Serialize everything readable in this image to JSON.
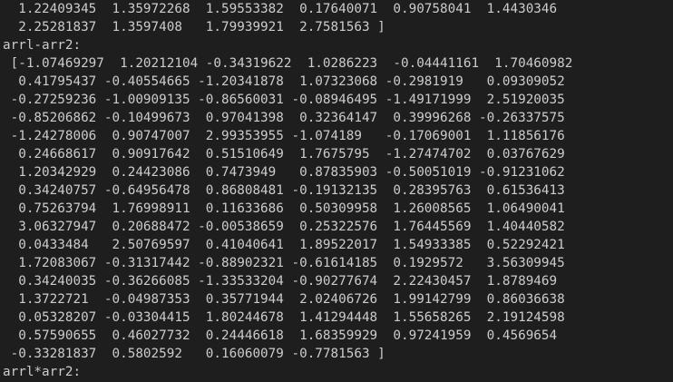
{
  "console": {
    "lines": [
      "  1.22409345  1.35972268  1.59553382  0.17640071  0.90758041  1.4430346",
      "  2.25281837  1.3597408   1.79939921  2.7581563 ]",
      "arrl-arr2:",
      " [-1.07469297  1.20212104 -0.34319622  1.0286223  -0.04441161  1.70460982",
      "  0.41795437 -0.40554665 -1.20341878  1.07323068 -0.2981919   0.09309052",
      " -0.27259236 -1.00909135 -0.86560031 -0.08946495 -1.49171999  2.51920035",
      " -0.85206862 -0.10499673  0.97041398  0.32364147  0.39996268 -0.26337575",
      " -1.24278006  0.90747007  2.99353955 -1.074189   -0.17069001  1.11856176",
      "  0.24668617  0.90917642  0.51510649  1.7675795  -1.27474702  0.03767629",
      "  1.20342929  0.24423086  0.7473949   0.87835903 -0.50051019 -0.91231062",
      "  0.34240757 -0.64956478  0.86808481 -0.19132135  0.28395763  0.61536413",
      "  0.75263794  1.76998911  0.11633686  0.50309958  1.26008565  1.06490041",
      "  3.06327947  0.20688472 -0.00538659  0.25322576  1.76445569  1.40440582",
      "  0.0433484   2.50769597  0.41040641  1.89522017  1.54933385  0.52292421",
      "  1.72083067 -0.31317442 -0.88902321 -0.61614185  0.1929572   3.56309945",
      "  0.34240035 -0.36266085 -1.33533204 -0.90277674  2.22430457  1.8789469",
      "  1.3722721  -0.04987353  0.35771944  2.02406726  1.99142799  0.86036638",
      "  0.05328207 -0.03304415  1.80244678  1.41294448  1.55658265  2.19124598",
      "  0.57590655  0.46027732  0.24446618  1.68359929  0.97241959  0.4569654",
      " -0.33281837  0.5802592   0.16060079 -0.7781563 ]",
      "arrl*arr2:"
    ]
  }
}
